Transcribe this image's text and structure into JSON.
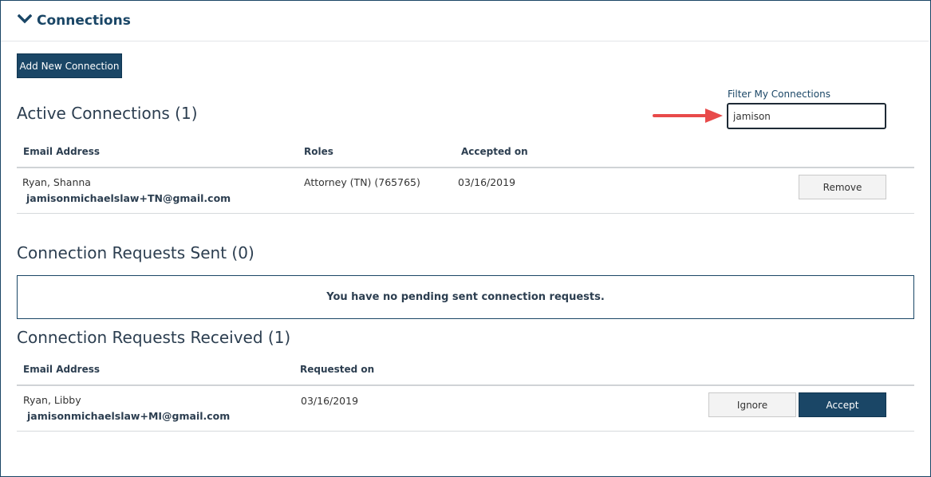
{
  "header": {
    "title": "Connections",
    "toggle_icon": "chevron-down-icon"
  },
  "actions": {
    "add_new_label": "Add New Connection"
  },
  "filter": {
    "label": "Filter My Connections",
    "value": "jamison",
    "placeholder": "",
    "arrow_color": "#e84a4a"
  },
  "active": {
    "title": "Active Connections (1)",
    "columns": [
      "Email Address",
      "Roles",
      "Accepted on"
    ],
    "rows": [
      {
        "name": "Ryan, Shanna",
        "email": "jamisonmichaelslaw+TN@gmail.com",
        "role": "Attorney (TN) (765765)",
        "date": "03/16/2019",
        "action": "Remove"
      }
    ]
  },
  "sent": {
    "title": "Connection Requests Sent (0)",
    "empty_message": "You have no pending sent connection requests."
  },
  "received": {
    "title": "Connection Requests Received (1)",
    "columns": [
      "Email Address",
      "Requested on"
    ],
    "rows": [
      {
        "name": "Ryan, Libby",
        "email": "jamisonmichaelslaw+MI@gmail.com",
        "date": "03/16/2019",
        "ignore_label": "Ignore",
        "accept_label": "Accept"
      }
    ]
  },
  "colors": {
    "primary": "#1a4666",
    "text": "#2c3e50",
    "border": "#d6d9dc"
  }
}
